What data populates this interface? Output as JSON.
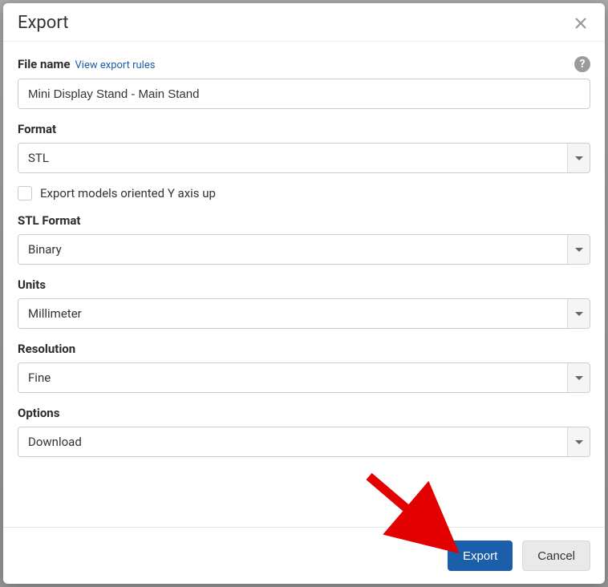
{
  "dialog": {
    "title": "Export",
    "help_tooltip": "?"
  },
  "file_name": {
    "label": "File name",
    "view_rules_link": "View export rules",
    "value": "Mini Display Stand - Main Stand"
  },
  "format": {
    "label": "Format",
    "value": "STL"
  },
  "y_axis": {
    "label": "Export models oriented Y axis up",
    "checked": false
  },
  "stl_format": {
    "label": "STL Format",
    "value": "Binary"
  },
  "units": {
    "label": "Units",
    "value": "Millimeter"
  },
  "resolution": {
    "label": "Resolution",
    "value": "Fine"
  },
  "options": {
    "label": "Options",
    "value": "Download"
  },
  "buttons": {
    "export": "Export",
    "cancel": "Cancel"
  }
}
